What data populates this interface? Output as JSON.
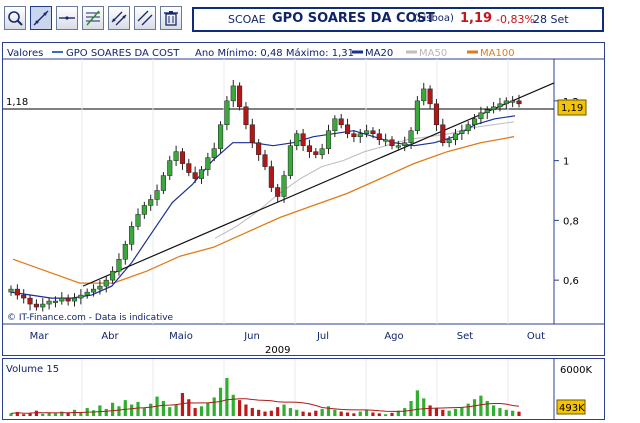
{
  "toolbar": {
    "buttons": [
      {
        "name": "zoom-tool-button",
        "icon": "magnifier-icon"
      },
      {
        "name": "draw-line-tool-button",
        "icon": "diagonal-line-icon"
      },
      {
        "name": "horizontal-line-tool-button",
        "icon": "horizontal-line-icon"
      },
      {
        "name": "fibonacci-tool-button",
        "icon": "fibonacci-icon"
      },
      {
        "name": "channel-tool-button",
        "icon": "channel-icon"
      },
      {
        "name": "parallel-lines-tool-button",
        "icon": "parallel-lines-icon"
      },
      {
        "name": "delete-tool-button",
        "icon": "trash-icon"
      }
    ]
  },
  "header": {
    "symbol": "SCOAE",
    "name": "GPO SOARES DA COST",
    "market": "(Lisboa)",
    "price": "1,19",
    "change": "-0,83%",
    "date": "28 Set"
  },
  "legend": {
    "valores": "Valores",
    "series_name": "GPO SOARES DA COST",
    "min_max": "Ano Mínimo: 0,48 Máximo: 1,31",
    "ma20": "MA20",
    "ma50": "MA50",
    "ma100": "MA100"
  },
  "colors": {
    "up_candle": "#3aa83a",
    "down_candle": "#b01818",
    "ma20": "#1a2f9a",
    "ma50": "#c0c0c0",
    "ma100": "#e07b1a",
    "trendline": "#111111",
    "frame": "#2b3f8f",
    "price_marker": "#f5c400",
    "volume_up": "#2fae2f",
    "volume_down": "#c01818",
    "volume_ma": "#b01818"
  },
  "price_axis": {
    "ticks": [
      "1,2",
      "1",
      "0,8",
      "0,6"
    ],
    "current_price_label": "1,19",
    "reference_line_label": "1,18"
  },
  "time_axis": {
    "months": [
      "Mar",
      "Abr",
      "Maio",
      "Jun",
      "Jul",
      "Ago",
      "Set",
      "Out"
    ],
    "year": "2009"
  },
  "watermark": "© IT-Finance.com - Data is indicative",
  "volume": {
    "title": "Volume 15",
    "scale_max": "6000K",
    "current_value": "493K"
  },
  "chart_data": {
    "type": "candlestick",
    "x": [
      "2009-03",
      "2009-04",
      "2009-05",
      "2009-06",
      "2009-07",
      "2009-08",
      "2009-09",
      "2009-10"
    ],
    "ylim": [
      0.47,
      1.32
    ],
    "yticks": [
      0.6,
      0.8,
      1.0,
      1.2
    ],
    "series": [
      {
        "name": "GPO SOARES DA COST",
        "close": [
          0.57,
          0.55,
          0.54,
          0.52,
          0.51,
          0.52,
          0.53,
          0.53,
          0.54,
          0.53,
          0.54,
          0.55,
          0.56,
          0.57,
          0.58,
          0.6,
          0.63,
          0.67,
          0.72,
          0.78,
          0.82,
          0.85,
          0.87,
          0.9,
          0.95,
          1.0,
          1.03,
          0.99,
          0.96,
          0.94,
          0.97,
          1.01,
          1.04,
          1.12,
          1.2,
          1.25,
          1.18,
          1.12,
          1.06,
          1.02,
          0.98,
          0.91,
          0.88,
          0.95,
          1.05,
          1.09,
          1.05,
          1.03,
          1.02,
          1.04,
          1.1,
          1.14,
          1.12,
          1.09,
          1.08,
          1.09,
          1.1,
          1.09,
          1.07,
          1.07,
          1.05,
          1.05,
          1.06,
          1.1,
          1.2,
          1.24,
          1.19,
          1.12,
          1.06,
          1.07,
          1.09,
          1.1,
          1.12,
          1.14,
          1.16,
          1.17,
          1.18,
          1.19,
          1.2,
          1.2,
          1.19
        ]
      },
      {
        "name": "MA20",
        "values": [
          0.56,
          0.55,
          0.54,
          0.54,
          0.55,
          0.58,
          0.66,
          0.76,
          0.86,
          0.92,
          1.0,
          1.06,
          1.06,
          1.05,
          1.06,
          1.08,
          1.09,
          1.1,
          1.08,
          1.06,
          1.05,
          1.06,
          1.08,
          1.12,
          1.14,
          1.15
        ]
      },
      {
        "name": "MA50",
        "values": [
          0.74,
          0.78,
          0.83,
          0.89,
          0.94,
          0.98,
          1.0,
          1.03,
          1.05,
          1.07,
          1.08,
          1.09,
          1.11,
          1.12,
          1.13
        ]
      },
      {
        "name": "MA100",
        "values": [
          0.67,
          0.63,
          0.59,
          0.59,
          0.63,
          0.68,
          0.71,
          0.76,
          0.81,
          0.85,
          0.89,
          0.94,
          0.99,
          1.03,
          1.06,
          1.08
        ]
      },
      {
        "name": "trendline",
        "values": [
          0.58,
          1.26
        ]
      }
    ]
  },
  "volume_data": {
    "unit": "K",
    "max": 6000,
    "values": [
      300,
      450,
      200,
      350,
      600,
      250,
      400,
      300,
      500,
      350,
      700,
      400,
      900,
      650,
      1200,
      800,
      1500,
      1100,
      1800,
      1300,
      1600,
      900,
      1400,
      2200,
      1700,
      1000,
      1300,
      2600,
      1900,
      900,
      1100,
      1500,
      2100,
      3200,
      4300,
      2400,
      1800,
      1300,
      900,
      700,
      500,
      600,
      1000,
      1300,
      900,
      700,
      500,
      400,
      600,
      800,
      1100,
      700,
      500,
      400,
      300,
      500,
      700,
      400,
      300,
      200,
      350,
      600,
      900,
      1700,
      2900,
      2000,
      1200,
      900,
      700,
      600,
      800,
      1000,
      1400,
      1900,
      2300,
      1700,
      1200,
      900,
      700,
      600,
      493
    ]
  }
}
